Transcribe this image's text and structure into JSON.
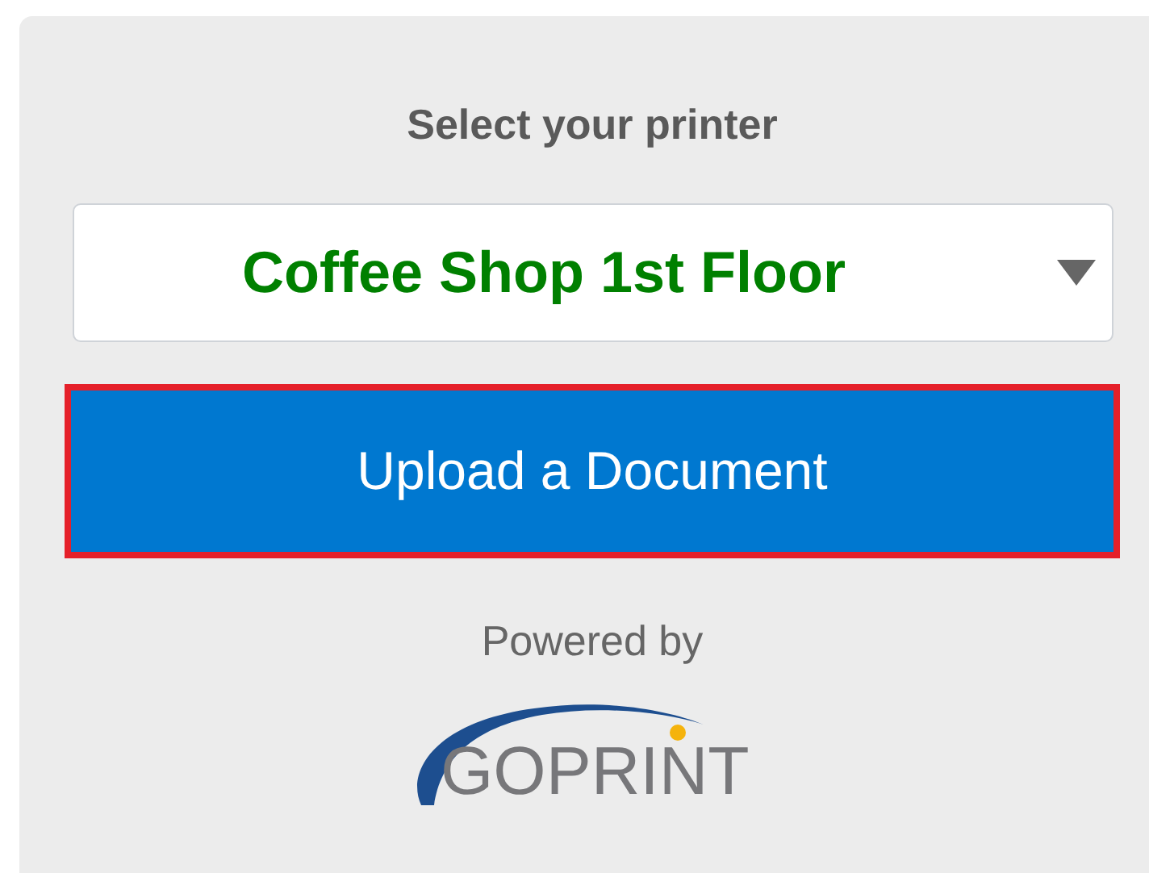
{
  "heading": "Select your printer",
  "printer_select": {
    "value": "Coffee Shop 1st Floor"
  },
  "upload_button": {
    "label": "Upload a Document",
    "focused": true
  },
  "powered_by": "Powered by",
  "logo": {
    "text": "GOPRINT"
  }
}
